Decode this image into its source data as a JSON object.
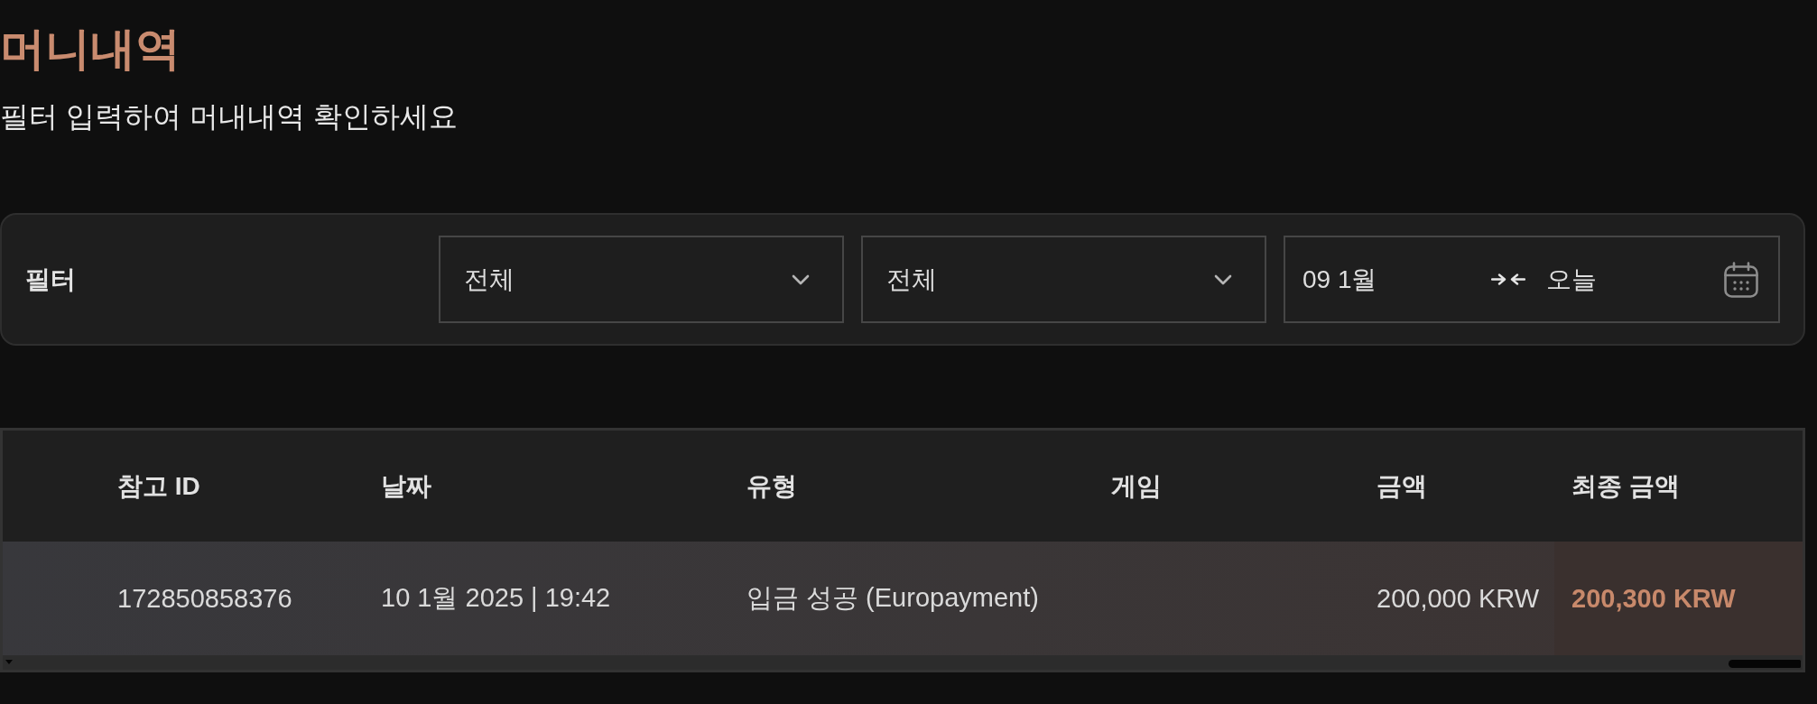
{
  "page": {
    "title": "머니내역",
    "subtitle": "필터 입력하여 머내내역 확인하세요"
  },
  "filter": {
    "label": "필터",
    "selects": [
      {
        "value": "전체"
      },
      {
        "value": "전체"
      }
    ],
    "date_range": {
      "start": "09 1월",
      "end": "오늘"
    }
  },
  "table": {
    "columns": [
      "참고 ID",
      "날짜",
      "유형",
      "게임",
      "금액",
      "최종 금액"
    ],
    "rows": [
      {
        "reference_id": "172850858376",
        "date": "10 1월 2025 | 19:42",
        "type": "입금 성공 (Europayment)",
        "amount": "200,000 KRW",
        "final_amount": "200,300 KRW"
      }
    ]
  }
}
